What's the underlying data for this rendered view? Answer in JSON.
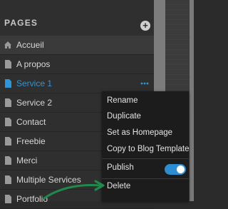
{
  "panel": {
    "title": "PAGES",
    "add_icon": "plus-circle-icon",
    "pages": [
      {
        "label": "Accueil",
        "icon": "home-icon"
      },
      {
        "label": "A propos",
        "icon": "page-icon"
      },
      {
        "label": "Service 1",
        "icon": "page-icon"
      },
      {
        "label": "Service 2",
        "icon": "page-icon"
      },
      {
        "label": "Contact",
        "icon": "page-icon"
      },
      {
        "label": "Freebie",
        "icon": "page-icon"
      },
      {
        "label": "Merci",
        "icon": "page-icon"
      },
      {
        "label": "Multiple Services",
        "icon": "page-icon"
      },
      {
        "label": "Portfolio",
        "icon": "page-icon"
      }
    ],
    "active_page": "Service 1",
    "more_icon": "more-horizontal-icon"
  },
  "context_menu": {
    "items": [
      {
        "label": "Rename"
      },
      {
        "label": "Duplicate"
      },
      {
        "label": "Set as Homepage"
      },
      {
        "label": "Copy to Blog Template"
      },
      {
        "label": "Publish",
        "toggle_on": true
      },
      {
        "label": "Delete"
      }
    ]
  },
  "colors": {
    "accent": "#2e96d8",
    "panel_bg": "#2f2f2f",
    "menu_bg": "#1c1c1c",
    "annotation_arrow": "#1f8a4c"
  }
}
